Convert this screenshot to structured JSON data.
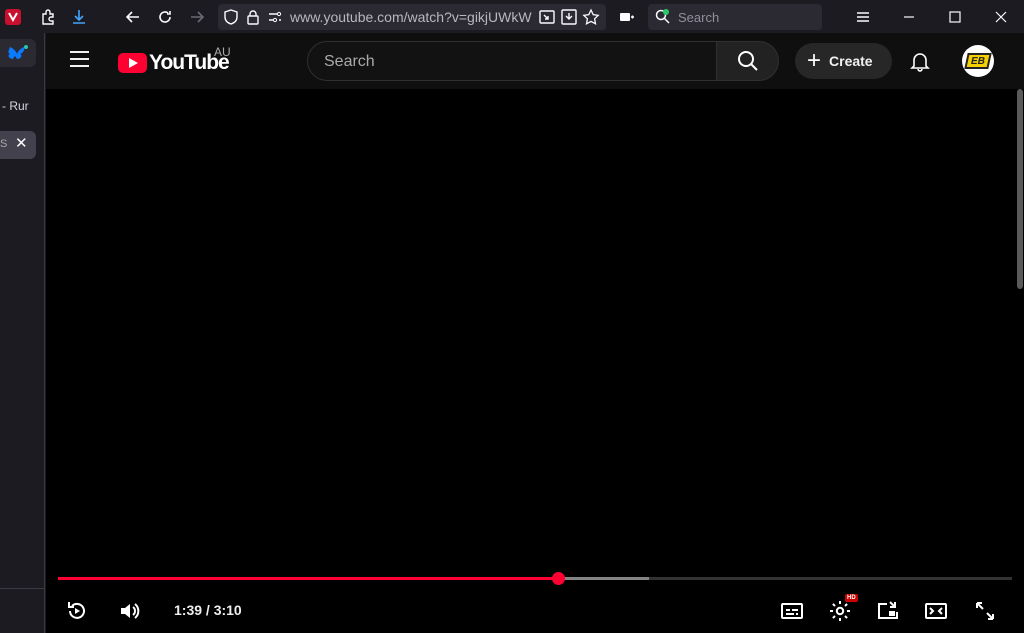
{
  "browser": {
    "url": "www.youtube.com/watch?v=gikjUWkW",
    "search_placeholder": "Search",
    "sidebar_tab_text": "- Rur",
    "sidebar_tab2_text": "S",
    "close_glyph": "✕"
  },
  "youtube": {
    "logo_text": "YouTube",
    "region": "AU",
    "search_placeholder": "Search",
    "create_label": "Create",
    "avatar_text": "EB"
  },
  "player": {
    "current_time": "1:39",
    "duration": "3:10",
    "time_display": "1:39 / 3:10",
    "played_fraction": 0.524,
    "buffered_fraction": 0.62,
    "settings_badge": "HD"
  },
  "colors": {
    "accent": "#ff0033",
    "page_bg": "#0f0f0f",
    "chrome_bg": "#1c1b22"
  }
}
